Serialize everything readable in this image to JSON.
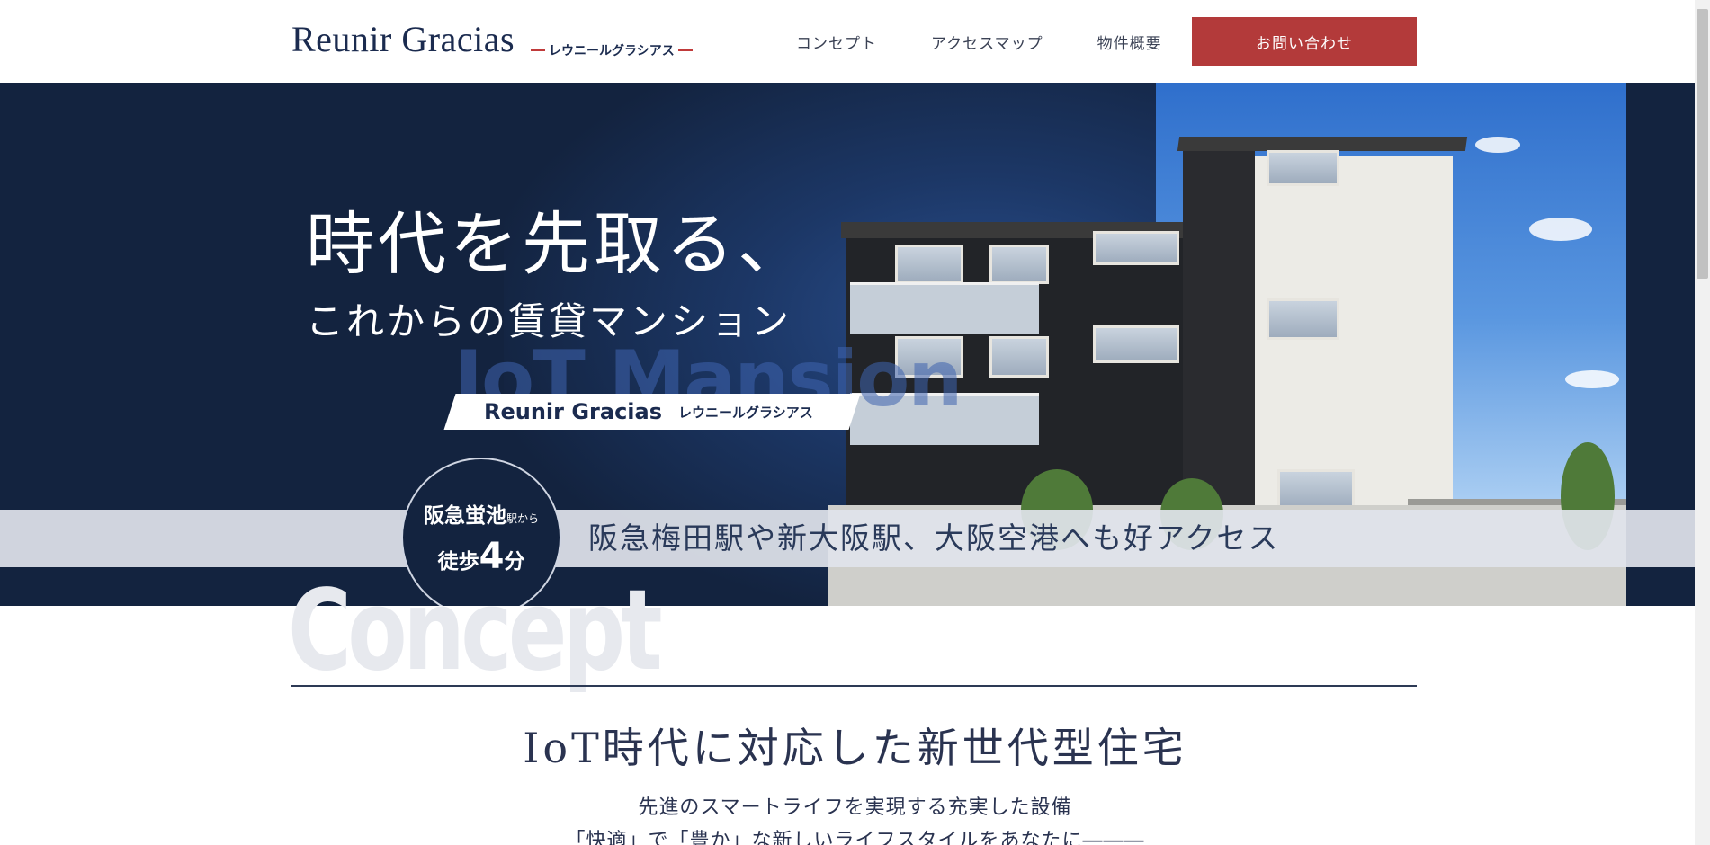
{
  "header": {
    "logo_main": "Reunir Gracias",
    "logo_sub": "レウニールグラシアス",
    "nav": [
      {
        "label": "コンセプト"
      },
      {
        "label": "アクセスマップ"
      },
      {
        "label": "物件概要"
      }
    ],
    "contact_label": "お問い合わせ"
  },
  "hero": {
    "title_line1": "時代を先取る、",
    "title_line2": "これからの賃貸マンション",
    "watermark": "IoT Mansion",
    "brand_main": "Reunir Gracias",
    "brand_sub": "レウニールグラシアス",
    "badge_station": "阪急蛍池",
    "badge_from": "駅から",
    "badge_walk": "徒歩",
    "badge_minutes": "4",
    "badge_unit": "分",
    "access_text": "阪急梅田駅や新大阪駅、大阪空港へも好アクセス"
  },
  "concept": {
    "watermark": "Concept",
    "heading": "IoT時代に対応した新世代型住宅",
    "line1": "先進のスマートライフを実現する充実した設備",
    "line2": "「快適」で「豊か」な新しいライフスタイルをあなたに―――"
  },
  "colors": {
    "navy": "#13233f",
    "accent_red": "#b33a3a"
  }
}
